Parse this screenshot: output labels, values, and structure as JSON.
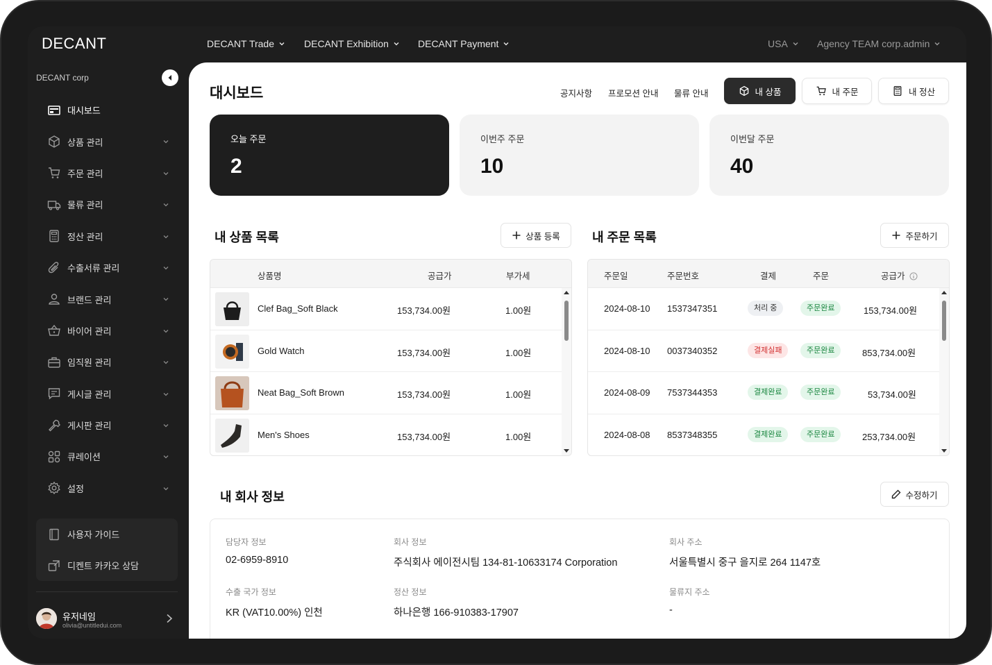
{
  "brand": {
    "logo": "DECANT",
    "accent": "#1e1e1e"
  },
  "topnav": {
    "items": [
      "DECANT Trade",
      "DECANT Exhibition",
      "DECANT Payment"
    ],
    "region": "USA",
    "account": "Agency TEAM corp.admin"
  },
  "sidebar": {
    "company": "DECANT corp",
    "items": [
      {
        "label": "대시보드",
        "icon": "dashboard-icon"
      },
      {
        "label": "상품 관리",
        "icon": "box-icon"
      },
      {
        "label": "주문 관리",
        "icon": "cart-icon"
      },
      {
        "label": "물류 관리",
        "icon": "truck-icon"
      },
      {
        "label": "정산 관리",
        "icon": "calculator-icon"
      },
      {
        "label": "수출서류 관리",
        "icon": "paperclip-icon"
      },
      {
        "label": "브랜드 관리",
        "icon": "user-icon"
      },
      {
        "label": "바이어 관리",
        "icon": "basket-icon"
      },
      {
        "label": "임직원 관리",
        "icon": "briefcase-icon"
      },
      {
        "label": "게시글 관리",
        "icon": "message-icon"
      },
      {
        "label": "게시판 관리",
        "icon": "tool-icon"
      },
      {
        "label": "큐레이션",
        "icon": "grid-icon"
      },
      {
        "label": "설정",
        "icon": "gear-icon"
      }
    ],
    "guide": [
      "사용자 가이드",
      "디켄트 카카오 상담"
    ],
    "user": {
      "name": "유저네임",
      "email": "olivia@untitledui.com"
    }
  },
  "header": {
    "title": "대시보드",
    "links": [
      "공지사항",
      "프로모션 안내",
      "물류 안내"
    ],
    "buttons": [
      "내 상품",
      "내 주문",
      "내 정산"
    ]
  },
  "stats": [
    {
      "label": "오늘 주문",
      "value": "2"
    },
    {
      "label": "이번주 주문",
      "value": "10"
    },
    {
      "label": "이번달 주문",
      "value": "40"
    }
  ],
  "products": {
    "title": "내 상품 목록",
    "add_label": "상품 등록",
    "columns": [
      "상품명",
      "공급가",
      "부가세"
    ],
    "rows": [
      {
        "name": "Clef Bag_Soft Black",
        "price": "153,734.00원",
        "vat": "1.00원"
      },
      {
        "name": "Gold Watch",
        "price": "153,734.00원",
        "vat": "1.00원"
      },
      {
        "name": "Neat Bag_Soft Brown",
        "price": "153,734.00원",
        "vat": "1.00원"
      },
      {
        "name": "Men's Shoes",
        "price": "153,734.00원",
        "vat": "1.00원"
      }
    ]
  },
  "orders": {
    "title": "내 주문 목록",
    "add_label": "주문하기",
    "columns": [
      "주문일",
      "주문번호",
      "결제",
      "주문",
      "공급가"
    ],
    "rows": [
      {
        "date": "2024-08-10",
        "no": "1537347351",
        "pay": "처리 중",
        "pay_tone": "gray",
        "order": "주문완료",
        "price": "153,734.00원"
      },
      {
        "date": "2024-08-10",
        "no": "0037340352",
        "pay": "결제실패",
        "pay_tone": "red",
        "order": "주문완료",
        "price": "853,734.00원"
      },
      {
        "date": "2024-08-09",
        "no": "7537344353",
        "pay": "결제완료",
        "pay_tone": "green",
        "order": "주문완료",
        "price": "53,734.00원"
      },
      {
        "date": "2024-08-08",
        "no": "8537348355",
        "pay": "결제완료",
        "pay_tone": "green",
        "order": "주문완료",
        "price": "253,734.00원"
      }
    ]
  },
  "company_info": {
    "title": "내 회사 정보",
    "edit_label": "수정하기",
    "fields": [
      {
        "label": "담당자 정보",
        "value": "02-6959-8910"
      },
      {
        "label": "회사 정보",
        "value": "주식회사 에이전시팀 134-81-10633174 Corporation"
      },
      {
        "label": "회사 주소",
        "value": "서울특별시 중구 을지로 264 1147호"
      },
      {
        "label": "수출 국가 정보",
        "value": "KR (VAT10.00%) 인천"
      },
      {
        "label": "정산 정보",
        "value": "하나은행 166-910383-17907"
      },
      {
        "label": "물류지 주소",
        "value": "-"
      }
    ]
  }
}
